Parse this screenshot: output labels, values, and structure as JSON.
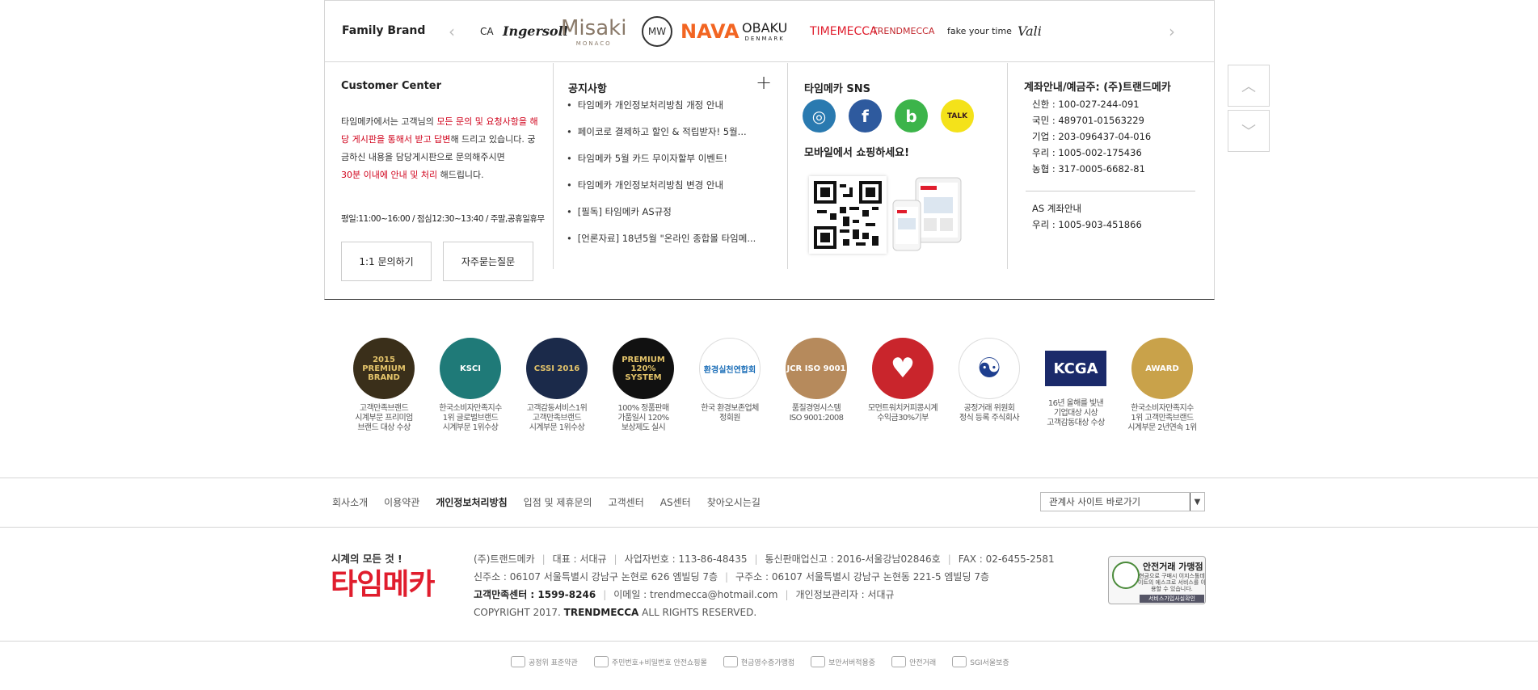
{
  "family_brand": {
    "title": "Family Brand",
    "prev_arrow": "‹",
    "next_arrow": "›",
    "logos": [
      {
        "text": "CA",
        "color": "#222"
      },
      {
        "text": "Ingersoll",
        "color": "#222"
      },
      {
        "text": "Misaki",
        "sub": "MONACO",
        "color": "#8a7a6a"
      },
      {
        "text": "MW",
        "color": "#333"
      },
      {
        "text": "NAVA",
        "color": "#f26522"
      },
      {
        "text": "OBAKU",
        "sub": "DENMARK",
        "color": "#222"
      },
      {
        "text": "TIMEMECCA",
        "color": "#e01d2d"
      },
      {
        "text": "TRENDMECCA",
        "color": "#c2272d"
      },
      {
        "text": "fake your time",
        "color": "#222"
      },
      {
        "text": "Vali",
        "color": "#222"
      }
    ]
  },
  "customer_center": {
    "title": "Customer Center",
    "text_1": "타임메카에서는 고객님의 ",
    "text_red_1": "모든 문의 및 요청사항을 해당 게시판을 통해서 받고 답변",
    "text_2": "해 드리고 있습니다. 궁금하신 내용을 담당게시판으로 문의해주시면",
    "text_red_2": "30분 이내에 안내 및 처리",
    "text_3": " 해드립니다.",
    "hours": "평일:11:00~16:00 / 점심12:30~13:40 / 주말,공휴일휴무",
    "btn_inquiry": "1:1 문의하기",
    "btn_faq": "자주묻는질문"
  },
  "notice": {
    "title": "공지사항",
    "plus": "+",
    "items": [
      "타임메카 개인정보처리방침 개정 안내",
      "페이코로 결제하고 할인 & 적립받자! 5월...",
      "타임메카 5월 카드 무이자할부 이벤트!",
      "타임메카 개인정보처리방침 변경 안내",
      "[필독] 타임메카 AS규정",
      "[언론자료] 18년5월 \"온라인 종합몰 타임메..."
    ]
  },
  "sns": {
    "title": "타임메카 SNS",
    "icons": [
      {
        "name": "instagram-icon",
        "glyph": "◎",
        "color": "#2a7ab0"
      },
      {
        "name": "facebook-icon",
        "glyph": "f",
        "color": "#2e5a9e"
      },
      {
        "name": "band-icon",
        "glyph": "b",
        "color": "#3cb44a"
      },
      {
        "name": "kakaotalk-icon",
        "glyph": "TALK",
        "color": "#f4e21a"
      }
    ],
    "mobile_title": "모바일에서 쇼핑하세요!"
  },
  "account": {
    "title": "계좌안내/예금주: (주)트랜드메카",
    "banks": [
      "신한 : 100-027-244-091",
      "국민 : 489701-01563229",
      "기업 : 203-096437-04-016",
      "우리 : 1005-002-175436",
      "농협 : 317-0005-6682-81"
    ],
    "as_title": "AS 계좌안내",
    "as_bank": "우리 : 1005-903-451866"
  },
  "scroll": {
    "up": "︿",
    "down": "﹀"
  },
  "awards": [
    {
      "badge": "2015 PREMIUM BRAND",
      "bg": "#3a2f1a",
      "fg": "#e4c46a",
      "cap": [
        "고객만족브랜드",
        "시계부문 프리미엄",
        "브랜드 대상 수상"
      ]
    },
    {
      "badge": "KSCI",
      "bg": "#1f7a78",
      "fg": "#ffffff",
      "cap": [
        "한국소비자만족지수",
        "1위 글로벌브랜드",
        "시계부문 1위수상"
      ]
    },
    {
      "badge": "CSSI 2016",
      "bg": "#1b2a4a",
      "fg": "#e4c46a",
      "cap": [
        "고객감동서비스1위",
        "고객만족브랜드",
        "시계부문 1위수상"
      ]
    },
    {
      "badge": "PREMIUM 120% SYSTEM",
      "bg": "#111111",
      "fg": "#e4c46a",
      "cap": [
        "100% 정품판매",
        "가품일시 120%",
        "보상제도 실시"
      ]
    },
    {
      "badge": "환경실천연합회",
      "bg": "#ffffff",
      "fg": "#1d6fb8",
      "cap": [
        "한국 환경보존업체",
        "정회원"
      ]
    },
    {
      "badge": "JCR ISO 9001",
      "bg": "#b68a5c",
      "fg": "#ffffff",
      "cap": [
        "품질경영시스템",
        "ISO 9001:2008"
      ]
    },
    {
      "badge": "♥",
      "bg": "#c9252c",
      "fg": "#ffffff",
      "cap": [
        "모먼트워치커피콩시계",
        "수익금30%기부"
      ]
    },
    {
      "badge": "☯",
      "bg": "#ffffff",
      "fg": "#1e3f8f",
      "cap": [
        "공정거래 위원회",
        "정식 등록 주식회사"
      ]
    },
    {
      "badge": "KCGA",
      "bg": "#1b2a6a",
      "fg": "#ffffff",
      "cap": [
        "16년 올해를 빛낸",
        "기업대상 시상",
        "고객감동대상 수상"
      ]
    },
    {
      "badge": "AWARD",
      "bg": "#c9a24a",
      "fg": "#ffffff",
      "cap": [
        "한국소비자만족지수",
        "1위 고객만족브랜드",
        "시계부문 2년연속 1위"
      ]
    }
  ],
  "footer": {
    "links": [
      {
        "label": "회사소개",
        "bold": false
      },
      {
        "label": "이용약관",
        "bold": false
      },
      {
        "label": "개인정보처리방침",
        "bold": true
      },
      {
        "label": "입점 및 제휴문의",
        "bold": false
      },
      {
        "label": "고객센터",
        "bold": false
      },
      {
        "label": "AS센터",
        "bold": false
      },
      {
        "label": "찾아오시는길",
        "bold": false
      }
    ],
    "family_select": "관계사 사이트 바로가기",
    "slogan": "시계의 모든 것 !",
    "logo": "타임메카",
    "company": "(주)트랜드메카",
    "ceo": "대표 : 서대규",
    "biz_no": "사업자번호 : 113-86-48435",
    "mail_order": "통신판매업신고 : 2016-서울강남02846호",
    "fax": "FAX : 02-6455-2581",
    "new_addr": "신주소 : 06107 서울특별시 강남구 논현로 626 엠빌딩 7층",
    "old_addr": "구주소 : 06107 서울특별시 강남구 논현동 221-5 엠빌딩 7층",
    "cs_label": "고객만족센터 : 1599-8246",
    "email": "이메일 : trendmecca@hotmail.com",
    "privacy_mgr": "개인정보관리자 : 서대규",
    "copy_1": "COPYRIGHT 2017. ",
    "copy_brand": "TRENDMECCA",
    "copy_2": " ALL RIGHTS RESERVED.",
    "seal_title": "안전거래 가맹점",
    "seal_sub": "현금으로 구매시 이지스톨데이트의 에스크로 서비스를 이용할 수 있습니다.",
    "seal_bar": "서비스가입사실확인"
  },
  "certs": [
    {
      "name": "fair-trade-icon",
      "label": "공정위 표준약관"
    },
    {
      "name": "lock-icon",
      "label": "주민번호+비밀번호 안전쇼핑몰"
    },
    {
      "name": "cash-receipt-icon",
      "label": "현금영수증가맹점"
    },
    {
      "name": "shield-icon",
      "label": "보안서버적용중"
    },
    {
      "name": "escrow-icon",
      "label": "안전거래"
    },
    {
      "name": "sgi-icon",
      "label": "SGI서울보증"
    }
  ]
}
